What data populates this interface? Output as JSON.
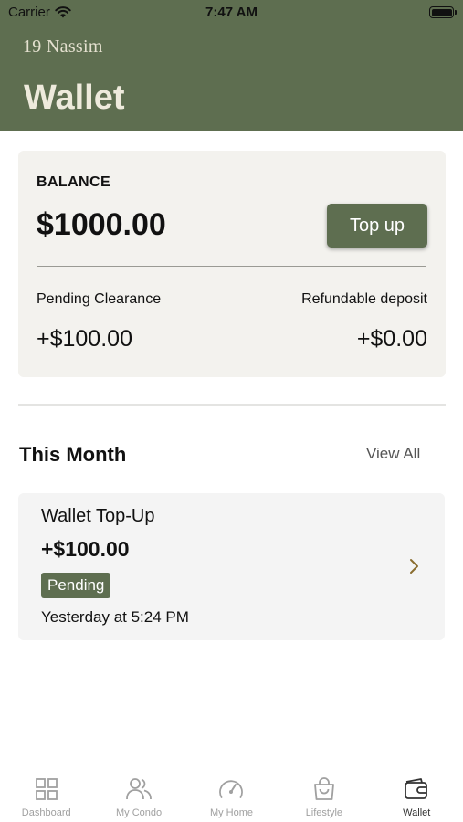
{
  "status_bar": {
    "carrier": "Carrier",
    "time": "7:47 AM"
  },
  "header": {
    "brand": "19 Nassim",
    "title": "Wallet"
  },
  "balance": {
    "label": "BALANCE",
    "amount": "$1000.00",
    "topup_label": "Top up",
    "pending_label": "Pending Clearance",
    "pending_amount": "+$100.00",
    "deposit_label": "Refundable deposit",
    "deposit_amount": "+$0.00"
  },
  "section": {
    "title": "This Month",
    "view_all": "View All"
  },
  "transactions": [
    {
      "title": "Wallet Top-Up",
      "amount": "+$100.00",
      "status": "Pending",
      "time": "Yesterday at 5:24 PM"
    }
  ],
  "tabs": [
    {
      "label": "Dashboard",
      "icon": "grid-icon",
      "active": false
    },
    {
      "label": "My Condo",
      "icon": "people-icon",
      "active": false
    },
    {
      "label": "My Home",
      "icon": "gauge-icon",
      "active": false
    },
    {
      "label": "Lifestyle",
      "icon": "bag-icon",
      "active": false
    },
    {
      "label": "Wallet",
      "icon": "wallet-icon",
      "active": true
    }
  ],
  "colors": {
    "primary": "#5e6e50",
    "header_text": "#eeeadc",
    "card_bg": "#f3f2ee",
    "chevron": "#8a6d2f"
  }
}
